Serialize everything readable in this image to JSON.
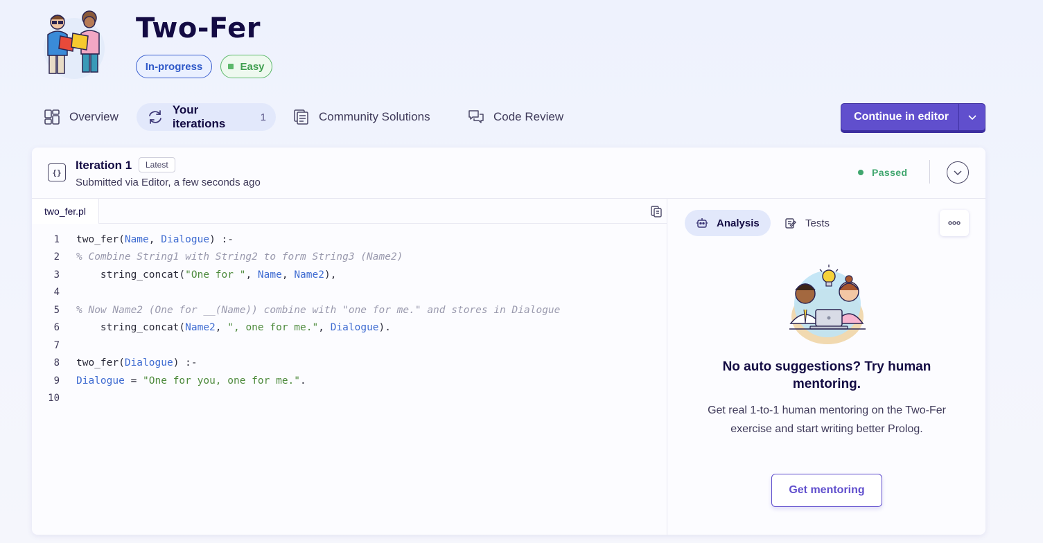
{
  "exercise": {
    "title": "Two-Fer",
    "status_tag": "In-progress",
    "difficulty_tag": "Easy",
    "icon": "two-people-puzzle-icon"
  },
  "tabs": [
    {
      "label": "Overview",
      "icon": "overview-icon"
    },
    {
      "label": "Your iterations",
      "count": "1",
      "icon": "iterations-icon"
    },
    {
      "label": "Community Solutions",
      "icon": "community-solutions-icon"
    },
    {
      "label": "Code Review",
      "icon": "code-review-icon"
    }
  ],
  "continue_button": {
    "label": "Continue in editor"
  },
  "iteration": {
    "title": "Iteration 1",
    "badge": "Latest",
    "subtitle": "Submitted via Editor, a few seconds ago",
    "status": "Passed"
  },
  "file": {
    "name": "two_fer.pl"
  },
  "code_lines": [
    "1",
    "2",
    "3",
    "4",
    "5",
    "6",
    "7",
    "8",
    "9",
    "10"
  ],
  "side": {
    "tab_analysis": "Analysis",
    "tab_tests": "Tests",
    "mentor_title": "No auto suggestions? Try human mentoring.",
    "mentor_desc": "Get real 1-to-1 human mentoring on the Two-Fer exercise and start writing better Prolog.",
    "mentor_button": "Get mentoring"
  },
  "colors": {
    "accent": "#604fcd",
    "passed": "#3fa66e",
    "status_blue": "#2e58c8",
    "easy_green": "#3f9e4f"
  }
}
